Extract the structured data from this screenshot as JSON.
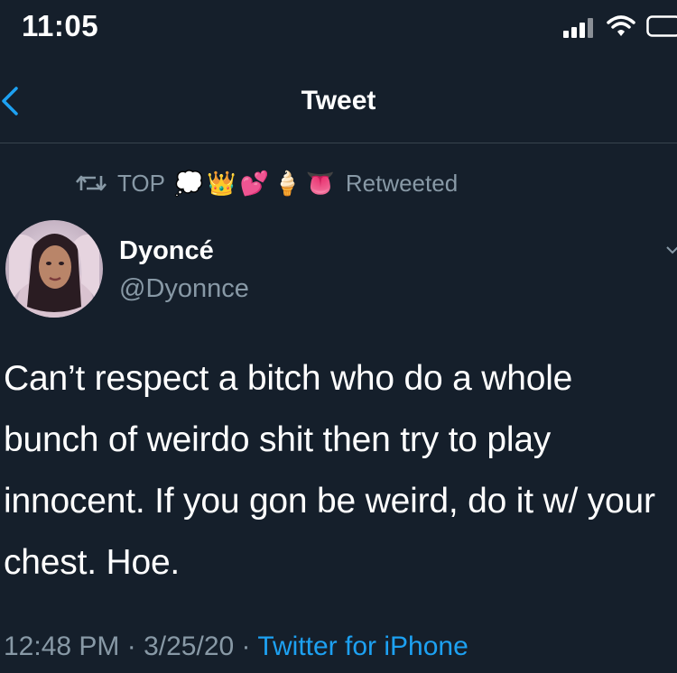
{
  "status_bar": {
    "time": "11:05"
  },
  "nav": {
    "title": "Tweet"
  },
  "retweet": {
    "label": "TOP",
    "emojis": [
      "💭",
      "👑",
      "💕",
      "🍦",
      "👅"
    ],
    "status": "Retweeted"
  },
  "tweet": {
    "display_name": "Dyoncé",
    "handle": "@Dyonnce",
    "text": "Can’t respect a bitch who do a whole bunch of weirdo shit then try to play innocent. If you gon be weird, do it w/ your chest. Hoe.",
    "time": "12:48 PM",
    "separator": " · ",
    "date": "3/25/20",
    "source": "Twitter for iPhone"
  },
  "colors": {
    "background": "#151f2b",
    "secondary_text": "#8899a6",
    "link": "#1da1f2",
    "divider": "#38444d"
  },
  "icons": {
    "back": "chevron-left-icon",
    "retweet": "retweet-icon",
    "signal": "cellular-signal-icon",
    "wifi": "wifi-icon",
    "battery": "battery-icon",
    "more": "chevron-down-icon"
  }
}
